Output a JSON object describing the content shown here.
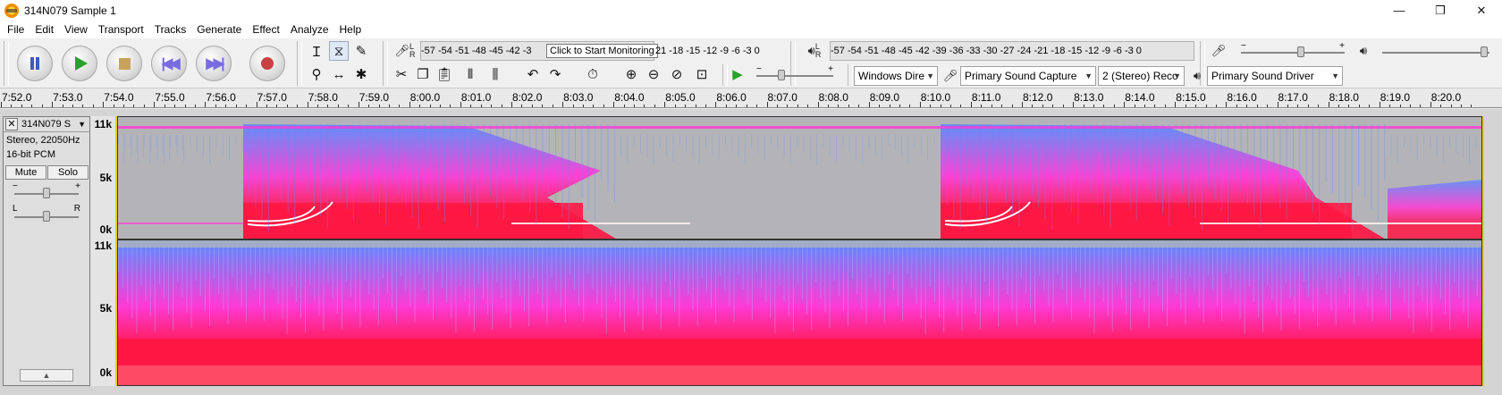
{
  "window": {
    "title": "314N079 Sample 1",
    "minimize_glyph": "—",
    "restore_glyph": "❐",
    "close_glyph": "✕"
  },
  "menu": [
    "File",
    "Edit",
    "View",
    "Transport",
    "Tracks",
    "Generate",
    "Effect",
    "Analyze",
    "Help"
  ],
  "meters": {
    "record_scale": "-57 -54 -51 -48 -45 -42 -3",
    "record_scale_tail": "21 -18 -15 -12 -9 -6 -3 0",
    "record_tooltip": "Click to Start Monitoring",
    "playback_scale": "-57 -54 -51 -48 -45 -42 -39 -36 -33 -30 -27 -24 -21 -18 -15 -12 -9 -6 -3 0"
  },
  "devices": {
    "host": "Windows Dire",
    "recording_device": "Primary Sound Capture",
    "channels": "2 (Stereo) Reco",
    "playback_device": "Primary Sound Driver"
  },
  "ruler": {
    "ticks": [
      "7:52.0",
      "7:53.0",
      "7:54.0",
      "7:55.0",
      "7:56.0",
      "7:57.0",
      "7:58.0",
      "7:59.0",
      "8:00.0",
      "8:01.0",
      "8:02.0",
      "8:03.0",
      "8:04.0",
      "8:05.0",
      "8:06.0",
      "8:07.0",
      "8:08.0",
      "8:09.0",
      "8:10.0",
      "8:11.0",
      "8:12.0",
      "8:13.0",
      "8:14.0",
      "8:15.0",
      "8:16.0",
      "8:17.0",
      "8:18.0",
      "8:19.0",
      "8:20.0"
    ]
  },
  "track": {
    "name": "314N079 S",
    "format": "Stereo, 22050Hz",
    "bit_depth": "16-bit PCM",
    "mute_label": "Mute",
    "solo_label": "Solo",
    "gain_minus": "−",
    "gain_plus": "+",
    "pan_left": "L",
    "pan_right": "R",
    "freq_labels": [
      "11k",
      "5k",
      "0k"
    ]
  },
  "colors": {
    "spectro_low": "#ff1744",
    "spectro_mid": "#ff3ad6",
    "spectro_high": "#5a8cff",
    "spectro_bg": "#b4b4b8"
  }
}
